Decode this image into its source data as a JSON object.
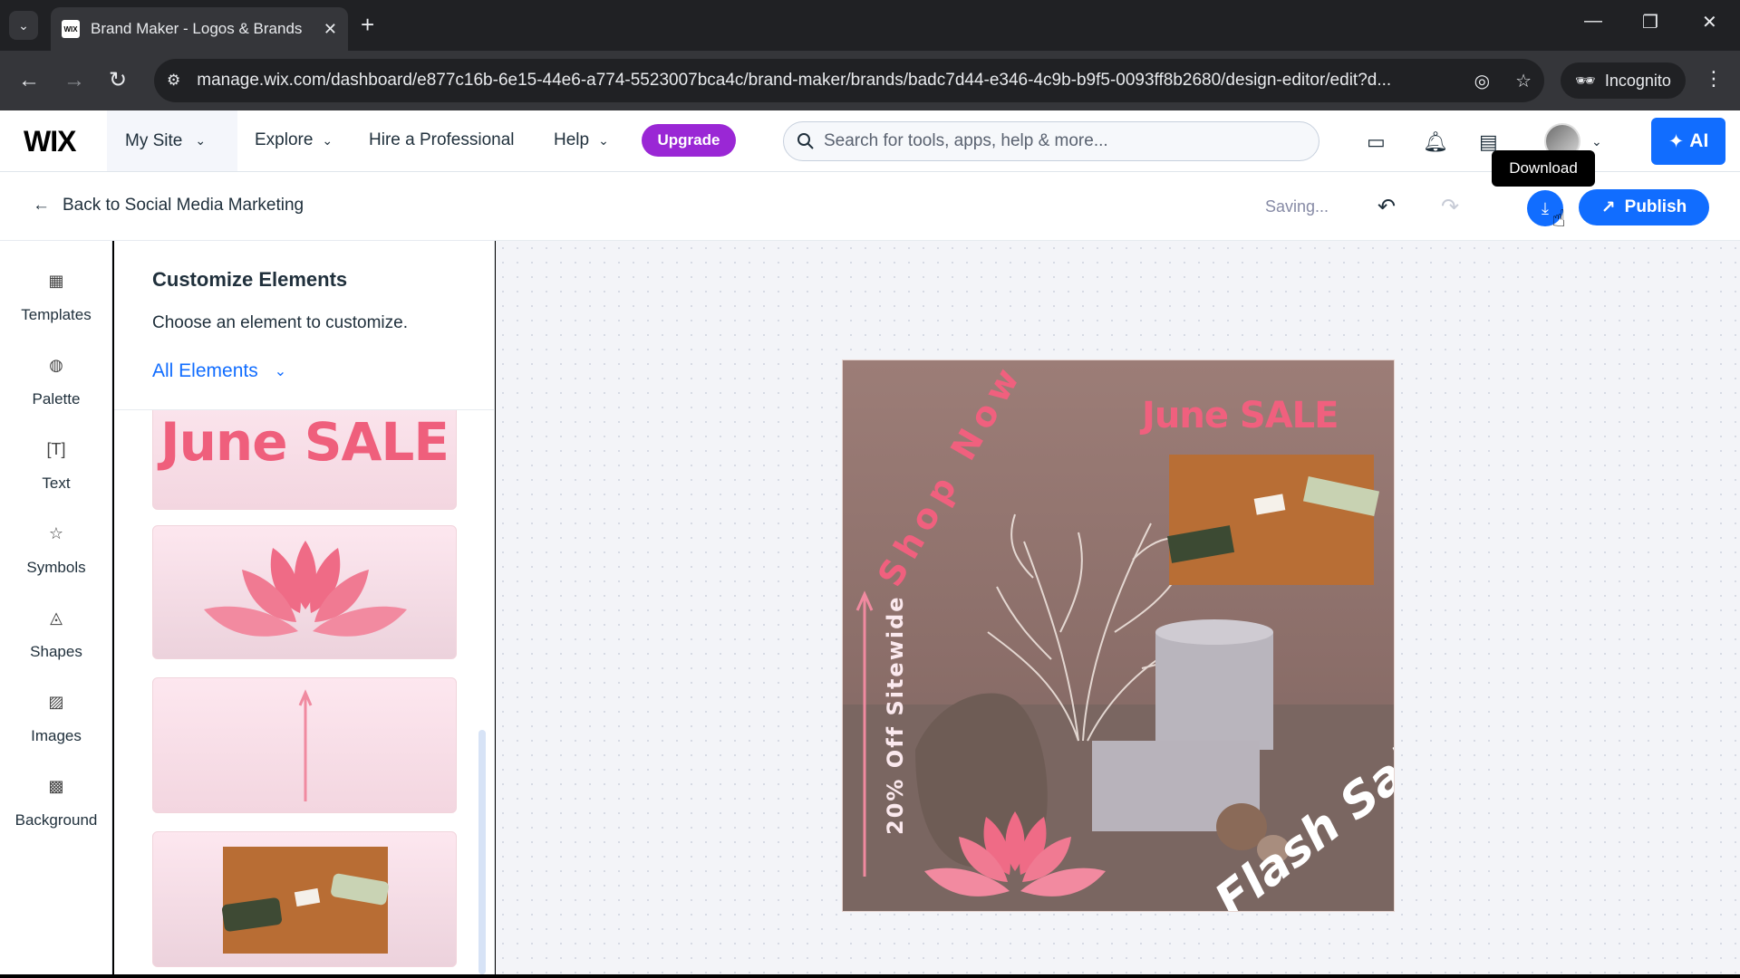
{
  "browser": {
    "tab_title": "Brand Maker - Logos & Brands",
    "tab_favicon": "WIX",
    "url": "manage.wix.com/dashboard/e877c16b-6e15-44e6-a774-5523007bca4c/brand-maker/brands/badc7d44-e346-4c9b-b9f5-0093ff8b2680/design-editor/edit?d...",
    "incognito_label": "Incognito"
  },
  "header": {
    "logo": "WIX",
    "my_site": "My Site",
    "explore": "Explore",
    "hire": "Hire a Professional",
    "help": "Help",
    "upgrade": "Upgrade",
    "search_placeholder": "Search for tools, apps, help & more...",
    "ai_label": "AI"
  },
  "subbar": {
    "back_label": "Back to Social Media Marketing",
    "status": "Saving...",
    "tooltip": "Download",
    "publish": "Publish"
  },
  "rail": {
    "items": [
      {
        "label": "Templates",
        "icon": "templates-icon"
      },
      {
        "label": "Palette",
        "icon": "palette-icon"
      },
      {
        "label": "Text",
        "icon": "text-icon"
      },
      {
        "label": "Symbols",
        "icon": "star-icon"
      },
      {
        "label": "Shapes",
        "icon": "shapes-icon"
      },
      {
        "label": "Images",
        "icon": "image-icon"
      },
      {
        "label": "Background",
        "icon": "background-icon"
      }
    ]
  },
  "panel": {
    "title": "Customize Elements",
    "subtitle": "Choose an element to customize.",
    "filter": "All Elements",
    "card_text": "June SALE"
  },
  "design": {
    "headline": "June SALE",
    "shop_now": "Shop Now",
    "discount": "20% Off Sitewide",
    "flash": "Flash Sale",
    "accent_color": "#f0607e",
    "background_color": "#8f7570"
  }
}
